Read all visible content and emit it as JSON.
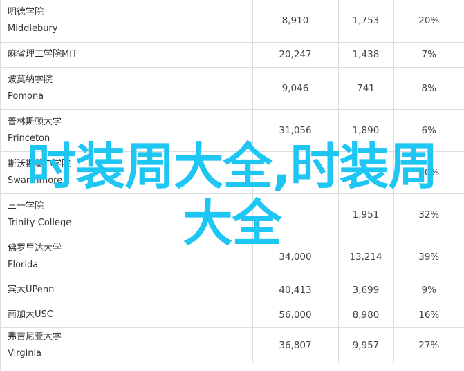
{
  "table": {
    "rows": [
      {
        "name_cn": "明德学院",
        "name_en": "Middlebury",
        "a": "8,910",
        "b": "1,753",
        "c": "20%",
        "layout": "tall"
      },
      {
        "name_cn": "麻省理工学院MIT",
        "name_en": "",
        "a": "20,247",
        "b": "1,438",
        "c": "7%",
        "layout": "short"
      },
      {
        "name_cn": "波莫纳学院",
        "name_en": "Pomona",
        "a": "9,046",
        "b": "741",
        "c": "8%",
        "layout": "tall"
      },
      {
        "name_cn": "普林斯顿大学",
        "name_en": "Princeton",
        "a": "31,056",
        "b": "1,890",
        "c": "6%",
        "layout": "tall"
      },
      {
        "name_cn": "斯沃斯莫尔学院",
        "name_en": "Swarthmore",
        "a": "",
        "b": "",
        "c": "10%",
        "layout": "tall"
      },
      {
        "name_cn": "三一学院",
        "name_en": "Trinity College",
        "a": "",
        "b": "1,951",
        "c": "32%",
        "layout": "tall"
      },
      {
        "name_cn": "佛罗里达大学",
        "name_en": "Florida",
        "a": "34,000",
        "b": "13,214",
        "c": "39%",
        "layout": "tall"
      },
      {
        "name_cn": "宾大UPenn",
        "name_en": "",
        "a": "40,413",
        "b": "3,699",
        "c": "9%",
        "layout": "short"
      },
      {
        "name_cn": "南加大USC",
        "name_en": "",
        "a": "56,000",
        "b": "8,980",
        "c": "16%",
        "layout": "short"
      },
      {
        "name_cn": "弗吉尼亚大学",
        "name_en": "Virginia",
        "a": "36,807",
        "b": "9,957",
        "c": "27%",
        "layout": "last"
      }
    ]
  },
  "overlay": {
    "text": "时装周大全,时装周大全",
    "color": "#1ec7f3"
  }
}
